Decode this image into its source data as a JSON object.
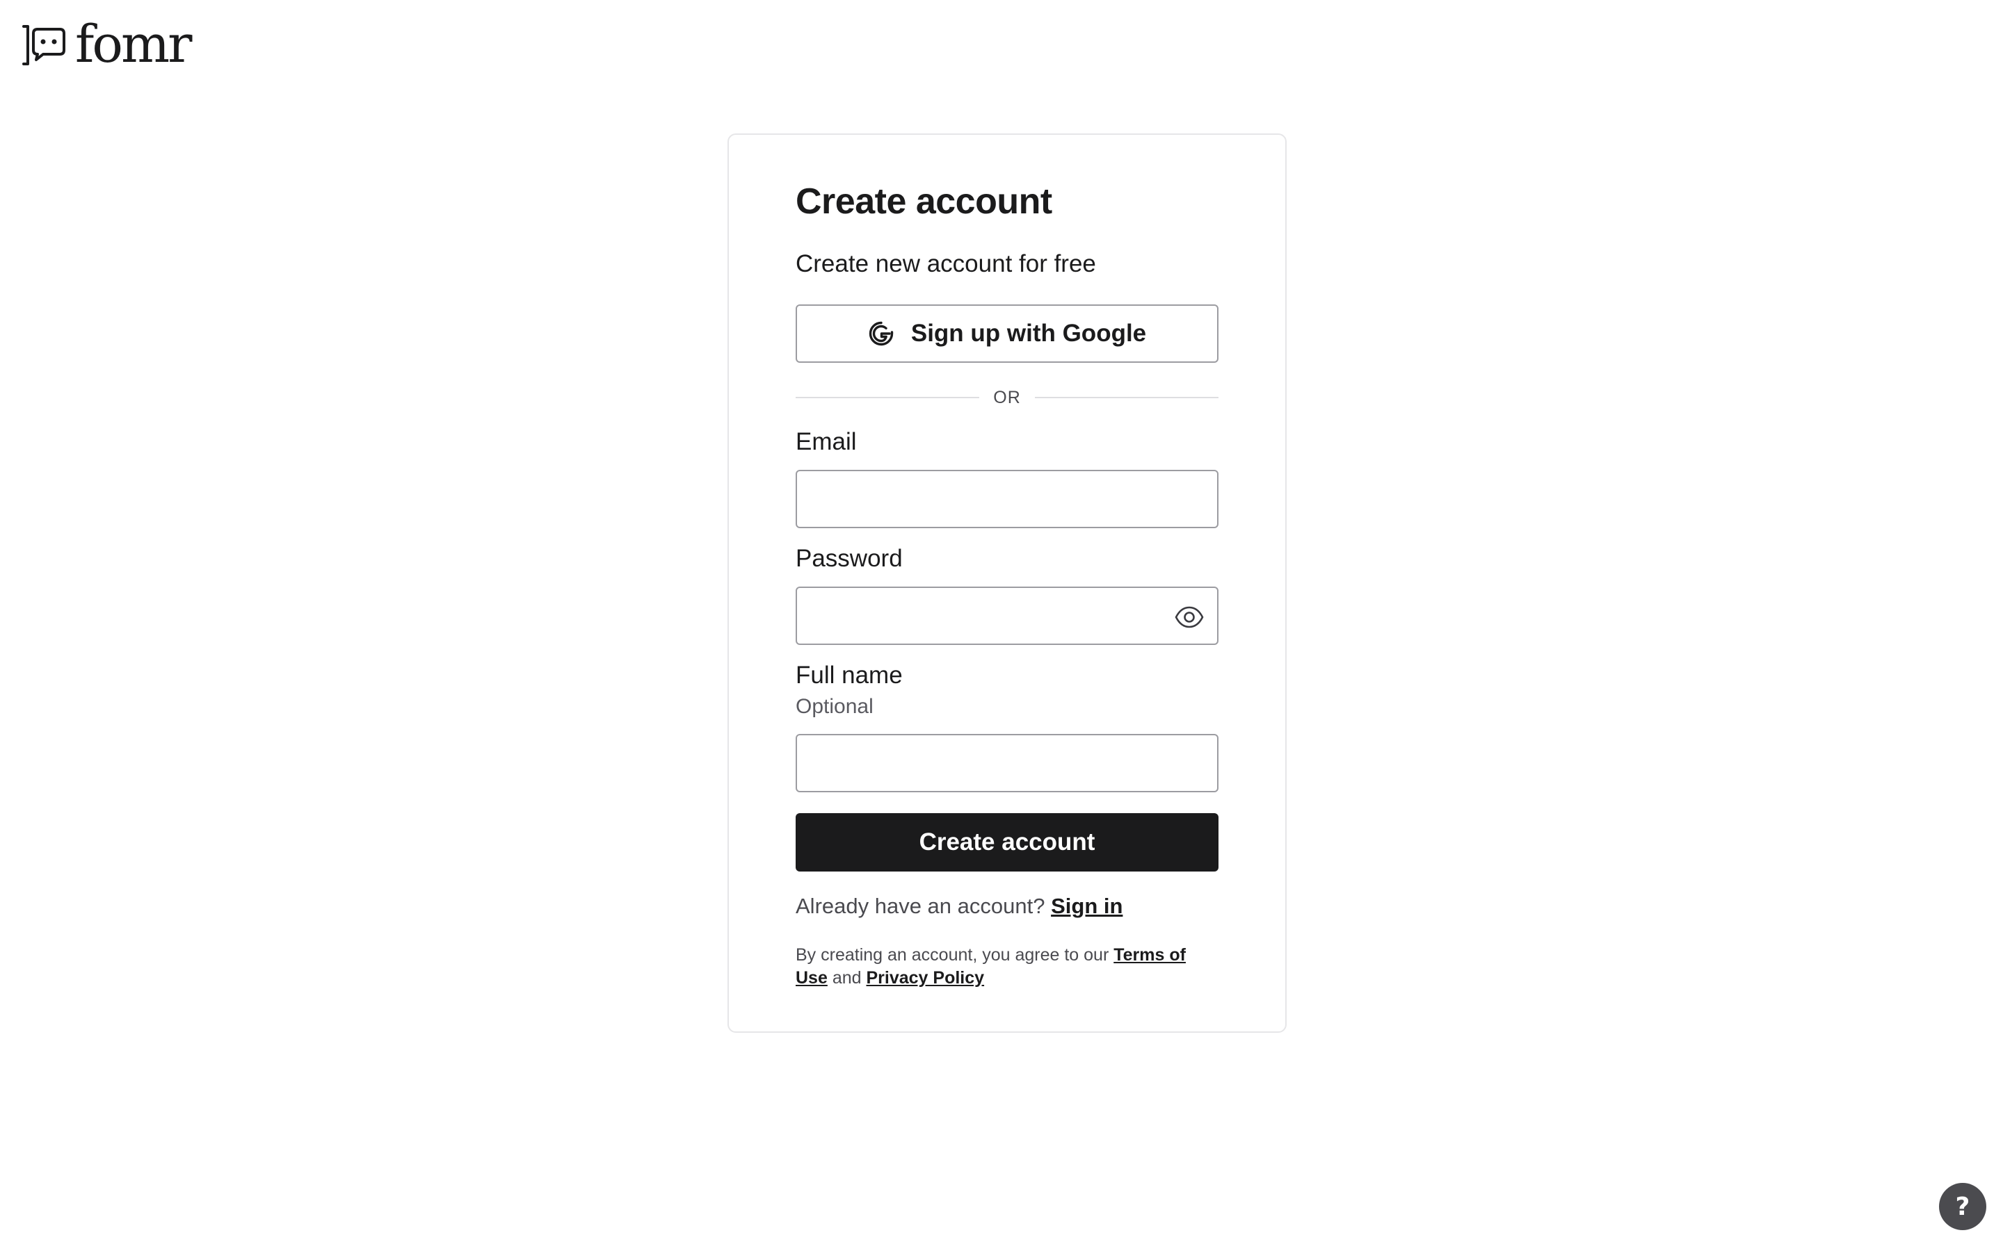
{
  "header": {
    "logo_text": "fomr",
    "logo_icon": "chat-bubble-logo-icon"
  },
  "signup": {
    "title": "Create account",
    "subtitle": "Create new account for free",
    "google_button_label": "Sign up with Google",
    "google_icon": "google-icon",
    "divider_text": "OR",
    "email": {
      "label": "Email",
      "value": "",
      "placeholder": ""
    },
    "password": {
      "label": "Password",
      "value": "",
      "placeholder": "",
      "toggle_icon": "eye-icon"
    },
    "full_name": {
      "label": "Full name",
      "hint": "Optional",
      "value": "",
      "placeholder": ""
    },
    "submit_label": "Create account",
    "signin_prompt": "Already have an account?",
    "signin_link": "Sign in",
    "legal_prefix": "By creating an account, you agree to our",
    "terms_link": "Terms of Use",
    "legal_conjunction": "and",
    "privacy_link": "Privacy Policy"
  },
  "help": {
    "label": "?"
  },
  "colors": {
    "primary_button": "#1b1b1c",
    "border": "#9c9ca1",
    "card_border": "#e6e6e8",
    "help_button": "#4b4b4f"
  }
}
